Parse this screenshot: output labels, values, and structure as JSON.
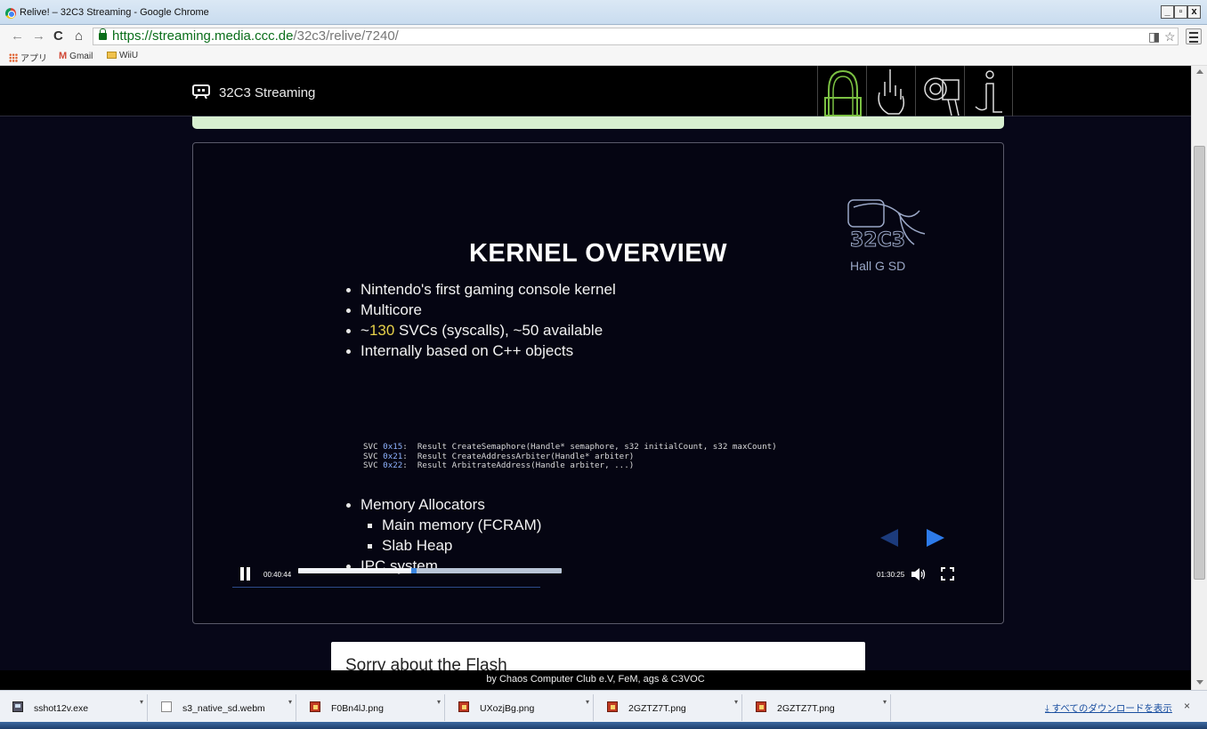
{
  "window": {
    "title": "Relive! – 32C3 Streaming - Google Chrome",
    "controls": [
      "_",
      "▫",
      "x"
    ]
  },
  "browser": {
    "url_host": "https://streaming.media.ccc.de",
    "url_path": "/32c3/relive/7240/",
    "bookmarks": [
      {
        "label": "アプリ",
        "icon": "apps-grid-icon"
      },
      {
        "label": "Gmail",
        "icon": "gmail-icon"
      },
      {
        "label": "WiiU",
        "icon": "folder-icon"
      }
    ]
  },
  "site": {
    "brand": "32C3 Streaming"
  },
  "slide": {
    "title": "KERNEL OVERVIEW",
    "watermark_label": "Hall G SD",
    "bullets": [
      {
        "text": "Nintendo's first gaming console kernel"
      },
      {
        "text": "Multicore"
      },
      {
        "pre": "~",
        "highlight": "130",
        "post": " SVCs (syscalls), ~50 available"
      },
      {
        "text": "Internally based on C++ objects"
      }
    ],
    "code": [
      {
        "svc": "SVC",
        "num": "0x15",
        "sig": ":  Result CreateSemaphore(Handle* semaphore, s32 initialCount, s32 maxCount)"
      },
      {
        "svc": "SVC",
        "num": "0x21",
        "sig": ":  Result CreateAddressArbiter(Handle* arbiter)"
      },
      {
        "svc": "SVC",
        "num": "0x22",
        "sig": ":  Result ArbitrateAddress(Handle arbiter, ...)"
      }
    ],
    "bullets2": [
      {
        "text": "Memory Allocators",
        "level": 0
      },
      {
        "text": "Main memory (FCRAM)",
        "level": 1
      },
      {
        "text": "Slab Heap",
        "level": 1
      },
      {
        "text": "IPC system",
        "level": 0
      }
    ]
  },
  "player": {
    "current_time": "00:40:44",
    "duration": "01:30:25",
    "progress": 0.4506
  },
  "flash_notice": "Sorry about the Flash",
  "footer": "by Chaos Computer Club e.V, FeM, ags & C3VOC",
  "downloads": {
    "items": [
      {
        "name": "sshot12v.exe",
        "type": "exe"
      },
      {
        "name": "s3_native_sd.webm",
        "type": "doc"
      },
      {
        "name": "F0Bn4lJ.png",
        "type": "png"
      },
      {
        "name": "UXozjBg.png",
        "type": "png"
      },
      {
        "name": "2GZTZ7T.png",
        "type": "png"
      },
      {
        "name": "2GZTZ7T.png",
        "type": "png"
      }
    ],
    "show_all": "すべてのダウンロードを表示",
    "close": "×"
  }
}
